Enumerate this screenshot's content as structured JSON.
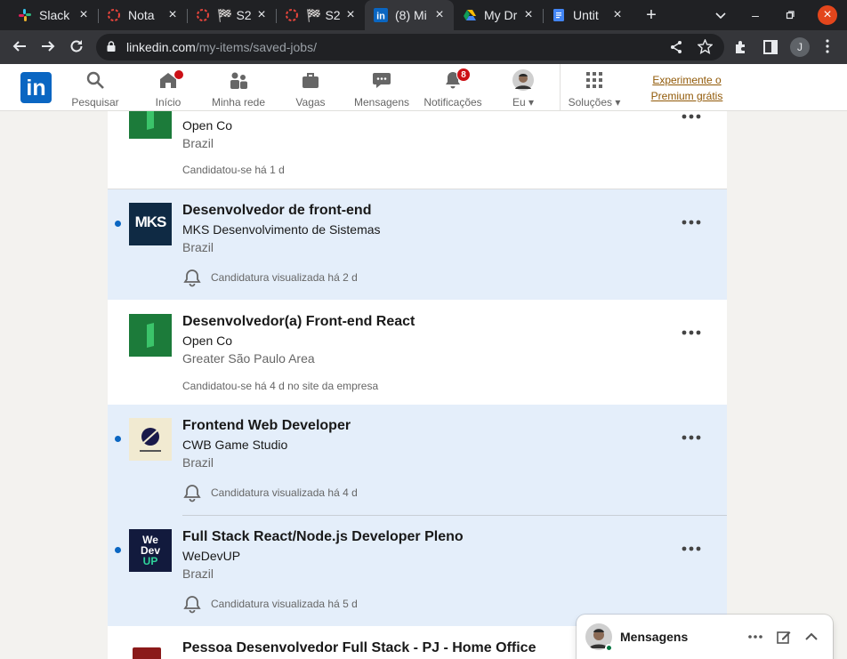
{
  "browser": {
    "tabs": [
      {
        "title": "Slack",
        "icon": "slack-icon"
      },
      {
        "title": "Nota",
        "icon": "loading-icon"
      },
      {
        "title": "S2",
        "icon": "loading-icon"
      },
      {
        "title": "S2",
        "icon": "loading-icon"
      },
      {
        "title": "(8) Mi",
        "icon": "linkedin-icon"
      },
      {
        "title": "My Dr",
        "icon": "google-drive-icon"
      },
      {
        "title": "Untit",
        "icon": "google-docs-icon"
      }
    ],
    "url_host": "linkedin.com",
    "url_path": "/my-items/saved-jobs/",
    "profile_initial": "J"
  },
  "nav": {
    "logo": "in",
    "items": [
      {
        "label": "Pesquisar"
      },
      {
        "label": "Início"
      },
      {
        "label": "Minha rede"
      },
      {
        "label": "Vagas"
      },
      {
        "label": "Mensagens"
      },
      {
        "label": "Notificações",
        "badge": "8"
      },
      {
        "label": "Eu ▾"
      },
      {
        "label": "Soluções ▾"
      }
    ],
    "premium_line1": "Experimente o",
    "premium_line2": "Premium grátis",
    "accent": "#0a66c2",
    "premium_color": "#915907"
  },
  "jobs": [
    {
      "title": "",
      "company": "Open Co",
      "location": "Brazil",
      "status": "Candidatou-se há 1 d",
      "viewed": false
    },
    {
      "title": "Desenvolvedor de front-end",
      "company": "MKS Desenvolvimento de Sistemas",
      "location": "Brazil",
      "status": "Candidatura visualizada há 2 d",
      "viewed": true
    },
    {
      "title": "Desenvolvedor(a) Front-end React",
      "company": "Open Co",
      "location": "Greater São Paulo Area",
      "status": "Candidatou-se há 4 d no site da empresa",
      "viewed": false
    },
    {
      "title": "Frontend Web Developer",
      "company": "CWB Game Studio",
      "location": "Brazil",
      "status": "Candidatura visualizada há 4 d",
      "viewed": true
    },
    {
      "title": "Full Stack React/Node.js Developer Pleno",
      "company": "WeDevUP",
      "location": "Brazil",
      "status": "Candidatura visualizada há 5 d",
      "viewed": true
    },
    {
      "title": "Pessoa Desenvolvedor Full Stack - PJ - Home Office",
      "company": "",
      "location": "",
      "status": "",
      "viewed": false
    }
  ],
  "logos": {
    "mks": "MKS",
    "wedevup_line1": "We",
    "wedevup_line2": "Dev",
    "wedevup_line3": "UP"
  },
  "messaging": {
    "label": "Mensagens"
  }
}
